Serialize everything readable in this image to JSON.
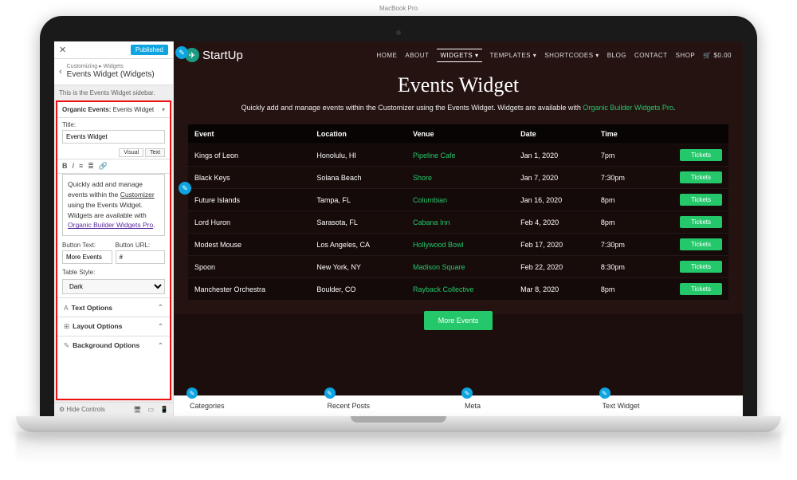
{
  "customizer": {
    "publish_btn": "Published",
    "breadcrumb": "Customizing ▸ Widgets",
    "title": "Events Widget (Widgets)",
    "description": "This is the Events Widget sidebar.",
    "widget_prefix": "Organic Events: ",
    "widget_name": "Events Widget",
    "title_label": "Title:",
    "title_value": "Events Widget",
    "tab_visual": "Visual",
    "tab_text": "Text",
    "editor_p1": "Quickly add and manage events within the ",
    "editor_cust": "Customizer",
    "editor_p2": " using the Events Widget. Widgets are available with ",
    "editor_link": "Organic Builder Widgets Pro",
    "btn_text_label": "Button Text:",
    "btn_text_value": "More Events",
    "btn_url_label": "Button URL:",
    "btn_url_value": "#",
    "table_style_label": "Table Style:",
    "table_style_value": "Dark",
    "acc_text": "Text Options",
    "acc_layout": "Layout Options",
    "acc_bg": "Background Options",
    "hide_controls": "Hide Controls"
  },
  "site": {
    "brand": "StartUp",
    "nav": [
      "HOME",
      "ABOUT",
      "WIDGETS ▾",
      "TEMPLATES ▾",
      "SHORTCODES ▾",
      "BLOG",
      "CONTACT",
      "SHOP"
    ],
    "cart_icon": "🛒",
    "cart_amount": "$0.00",
    "page_title": "Events Widget",
    "subtitle_a": "Quickly add and manage events within the Customizer using the Events Widget. Widgets are available with ",
    "subtitle_link": "Organic Builder Widgets Pro",
    "th": [
      "Event",
      "Location",
      "Venue",
      "Date",
      "Time",
      ""
    ],
    "rows": [
      {
        "event": "Kings of Leon",
        "loc": "Honolulu, HI",
        "venue": "Pipeline Cafe",
        "date": "Jan 1, 2020",
        "time": "7pm"
      },
      {
        "event": "Black Keys",
        "loc": "Solana Beach",
        "venue": "Shore",
        "date": "Jan 7, 2020",
        "time": "7:30pm"
      },
      {
        "event": "Future Islands",
        "loc": "Tampa, FL",
        "venue": "Columbian",
        "date": "Jan 16, 2020",
        "time": "8pm"
      },
      {
        "event": "Lord Huron",
        "loc": "Sarasota, FL",
        "venue": "Cabana Inn",
        "date": "Feb 4, 2020",
        "time": "8pm"
      },
      {
        "event": "Modest Mouse",
        "loc": "Los Angeles, CA",
        "venue": "Hollywood Bowl",
        "date": "Feb 17, 2020",
        "time": "7:30pm"
      },
      {
        "event": "Spoon",
        "loc": "New York, NY",
        "venue": "Madison Square",
        "date": "Feb 22, 2020",
        "time": "8:30pm"
      },
      {
        "event": "Manchester Orchestra",
        "loc": "Boulder, CO",
        "venue": "Rayback Collective",
        "date": "Mar 8, 2020",
        "time": "8pm"
      }
    ],
    "tickets_label": "Tickets",
    "more_events": "More Events",
    "footer_widgets": [
      "Categories",
      "Recent Posts",
      "Meta",
      "Text Widget"
    ]
  },
  "device": {
    "label": "MacBook Pro"
  }
}
